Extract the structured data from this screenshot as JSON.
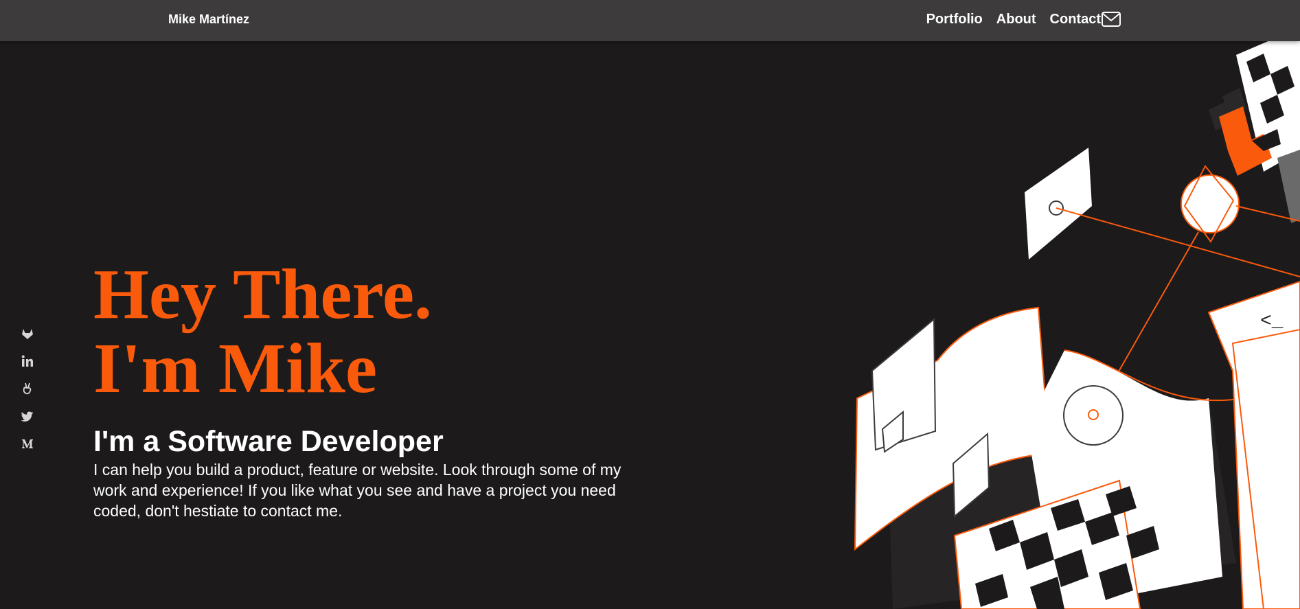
{
  "nav": {
    "brand": "Mike Martínez",
    "links": [
      {
        "label": "Portfolio"
      },
      {
        "label": "About"
      },
      {
        "label": "Contact",
        "icon": "mail-icon"
      }
    ]
  },
  "social": [
    {
      "icon": "gitlab-icon"
    },
    {
      "icon": "linkedin-icon"
    },
    {
      "icon": "angellist-icon"
    },
    {
      "icon": "twitter-icon"
    },
    {
      "icon": "medium-icon"
    }
  ],
  "hero": {
    "line1": "Hey There.",
    "line2": "I'm Mike",
    "role": "I'm a Software Developer",
    "description": "I can help you build a product, feature or website. Look through some of my work and experience! If you like what you see and have a project you need coded, don't hestiate to contact me."
  },
  "illustration": {
    "code_text": "<_",
    "colors": {
      "accent": "#fa5a0c",
      "background": "#1c1a1a",
      "navbar": "#3d3b3c",
      "white": "#ffffff"
    }
  }
}
